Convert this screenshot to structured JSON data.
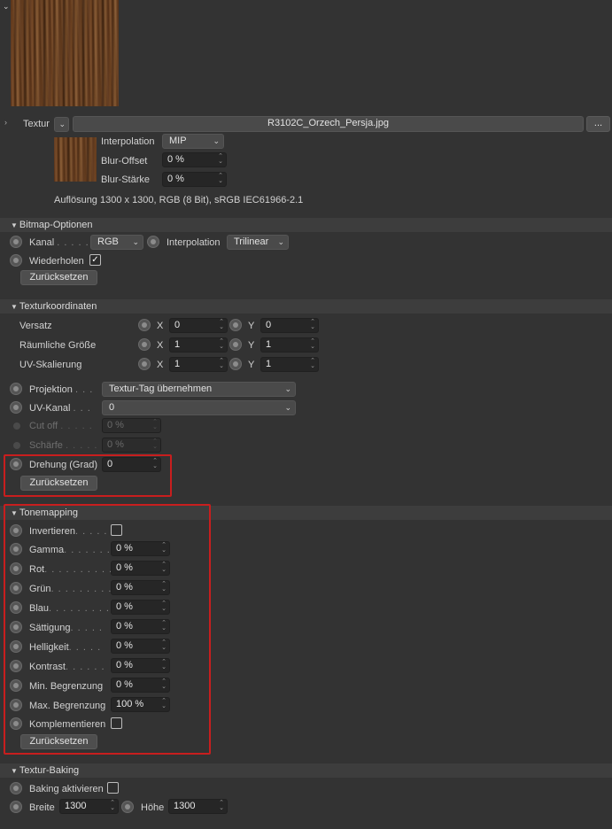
{
  "texture": {
    "label": "Textur",
    "filename": "R3102C_Orzech_Persja.jpg",
    "more_button": "...",
    "interpolation_label": "Interpolation",
    "interpolation_value": "MIP",
    "blur_offset_label": "Blur-Offset",
    "blur_offset_value": "0 %",
    "blur_strength_label": "Blur-Stärke",
    "blur_strength_value": "0 %",
    "resolution_info": "Auflösung 1300 x 1300, RGB (8 Bit), sRGB IEC61966-2.1"
  },
  "bitmap": {
    "title": "Bitmap-Optionen",
    "kanal_label": "Kanal",
    "kanal_dots": ". . . . .",
    "kanal_value": "RGB",
    "interpolation_label": "Interpolation",
    "interpolation_value": "Trilinear",
    "repeat_label": "Wiederholen",
    "reset_label": "Zurücksetzen"
  },
  "coords": {
    "title": "Texturkoordinaten",
    "rows": [
      {
        "label": "Versatz",
        "x_label": "X",
        "x": "0",
        "y_label": "Y",
        "y": "0"
      },
      {
        "label": "Räumliche Größe",
        "x_label": "X",
        "x": "1",
        "y_label": "Y",
        "y": "1"
      },
      {
        "label": "UV-Skalierung",
        "x_label": "X",
        "x": "1",
        "y_label": "Y",
        "y": "1"
      }
    ],
    "projection_label": "Projektion",
    "projection_dots": ". . .",
    "projection_value": "Textur-Tag übernehmen",
    "uv_label": "UV-Kanal",
    "uv_dots": ". . .",
    "uv_value": "0",
    "cutoff_label": "Cut off",
    "cutoff_dots": ". . . . .",
    "cutoff_value": "0 %",
    "sharpness_label": "Schärfe",
    "sharpness_dots": ". . . . .",
    "sharpness_value": "0 %",
    "rotation_label": "Drehung (Grad)",
    "rotation_value": "0",
    "reset_label": "Zurücksetzen"
  },
  "tonemapping": {
    "title": "Tonemapping",
    "invert_label": "Invertieren",
    "invert_dots": ". . . . .",
    "rows": [
      {
        "label": "Gamma",
        "dots": ". . . . . . .",
        "value": "0 %"
      },
      {
        "label": "Rot",
        "dots": ". . . . . . . . . .",
        "value": "0 %"
      },
      {
        "label": "Grün",
        "dots": ". . . . . . . . .",
        "value": "0 %"
      },
      {
        "label": "Blau",
        "dots": ". . . . . . . . .",
        "value": "0 %"
      },
      {
        "label": "Sättigung",
        "dots": ". . . . .",
        "value": "0 %"
      },
      {
        "label": "Helligkeit",
        "dots": ". . . . .",
        "value": "0 %"
      },
      {
        "label": "Kontrast",
        "dots": ". . . . . .",
        "value": "0 %"
      },
      {
        "label": "Min. Begrenzung",
        "dots": "",
        "value": "0 %"
      },
      {
        "label": "Max. Begrenzung",
        "dots": "",
        "value": "100 %"
      }
    ],
    "complement_label": "Komplementieren",
    "reset_label": "Zurücksetzen"
  },
  "baking": {
    "title": "Textur-Baking",
    "enable_label": "Baking aktivieren",
    "width_label": "Breite",
    "width_value": "1300",
    "height_label": "Höhe",
    "height_value": "1300"
  },
  "colors": {
    "background": "#333333",
    "section_header": "#3d3d3d",
    "field": "#262626",
    "highlight_box": "#c81e1e"
  }
}
